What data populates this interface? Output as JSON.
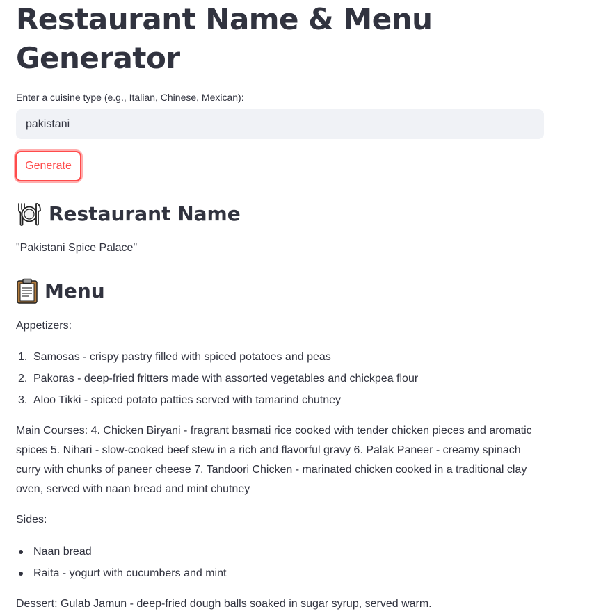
{
  "page": {
    "title": "Restaurant Name & Menu Generator"
  },
  "form": {
    "label": "Enter a cuisine type (e.g., Italian, Chinese, Mexican):",
    "value": "pakistani",
    "button_label": "Generate"
  },
  "restaurant": {
    "heading": "Restaurant Name",
    "heading_icon": "plate-cutlery-icon",
    "name": "\"Pakistani Spice Palace\""
  },
  "menu": {
    "heading": "Menu",
    "heading_icon": "clipboard-icon",
    "appetizers_label": "Appetizers:",
    "appetizers": [
      "Samosas - crispy pastry filled with spiced potatoes and peas",
      "Pakoras - deep-fried fritters made with assorted vegetables and chickpea flour",
      "Aloo Tikki - spiced potato patties served with tamarind chutney"
    ],
    "main_courses": "Main Courses: 4. Chicken Biryani - fragrant basmati rice cooked with tender chicken pieces and aromatic spices 5. Nihari - slow-cooked beef stew in a rich and flavorful gravy 6. Palak Paneer - creamy spinach curry with chunks of paneer cheese 7. Tandoori Chicken - marinated chicken cooked in a traditional clay oven, served with naan bread and mint chutney",
    "sides_label": "Sides:",
    "sides": [
      "Naan bread",
      "Raita - yogurt with cucumbers and mint"
    ],
    "dessert": "Dessert: Gulab Jamun - deep-fried dough balls soaked in sugar syrup, served warm."
  },
  "colors": {
    "text": "#31333f",
    "accent": "#ff4b4b",
    "input_bg": "#f0f2f6"
  }
}
